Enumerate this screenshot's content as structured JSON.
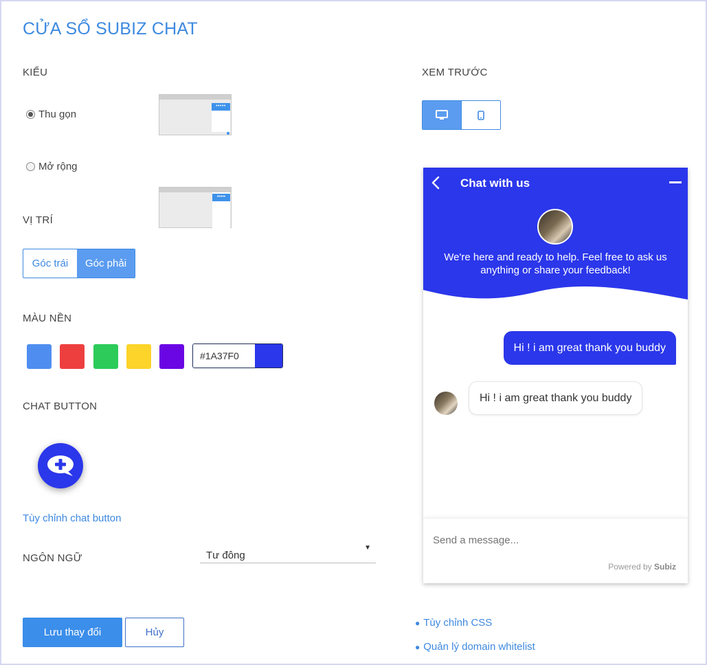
{
  "page_title": "CỬA SỔ SUBIZ CHAT",
  "style_section": {
    "label": "KIỂU",
    "options": [
      {
        "label": "Thu gọn",
        "checked": true,
        "thumb_dots": "•••••"
      },
      {
        "label": "Mở rộng",
        "checked": false,
        "thumb_dots": "•••••"
      }
    ]
  },
  "position_section": {
    "label": "VỊ TRÍ",
    "options": [
      {
        "label": "Góc trái",
        "selected": false
      },
      {
        "label": "Góc phải",
        "selected": true
      }
    ]
  },
  "color_section": {
    "label": "MÀU NỀN",
    "swatches": [
      "#4f8ef0",
      "#ee3f3f",
      "#2ccb5a",
      "#fcd42a",
      "#6a05e4"
    ],
    "hex_value": "#1A37F0",
    "current_color": "#2b37ea"
  },
  "chat_button_section": {
    "label": "CHAT BUTTON",
    "customize_link": "Tùy chỉnh chat button"
  },
  "language_section": {
    "label": "NGÔN NGỮ",
    "selected": "Tư đông"
  },
  "actions": {
    "save": "Lưu thay đổi",
    "cancel": "Hủy"
  },
  "preview": {
    "label": "XEM TRƯỚC",
    "devices": [
      {
        "name": "desktop-icon",
        "selected": true
      },
      {
        "name": "mobile-icon",
        "selected": false
      }
    ],
    "chat": {
      "title": "Chat with us",
      "welcome": "We're here and ready to help. Feel free to ask us anything or share your feedback!",
      "outgoing_message": "Hi ! i am great thank you buddy",
      "incoming_message": "Hi ! i am great thank you buddy",
      "composer_placeholder": "Send a message...",
      "powered_by": "Powered by",
      "brand": "Subiz"
    }
  },
  "extra_links": [
    "Tùy chỉnh CSS",
    "Quản lý domain whitelist"
  ],
  "colors": {
    "accent": "#3e89e0",
    "chat_primary": "#2b37ea"
  }
}
